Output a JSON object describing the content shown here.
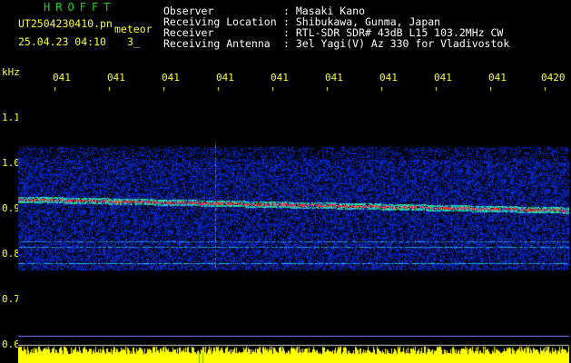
{
  "header": {
    "title": "HROFFT",
    "filename": "UT2504230410.pn",
    "filename_suffix": "meteor",
    "datetime": "25.04.23 04:10",
    "count": "3_",
    "observer_label": "Observer",
    "observer_value": ": Masaki Kano",
    "location_label": "Receiving Location",
    "location_value": ": Shibukawa, Gunma, Japan",
    "receiver_label": "Receiver",
    "receiver_value": ": RTL-SDR SDR# 43dB L15 103.2MHz CW",
    "antenna_label": "Receiving Antenna",
    "antenna_value": ": 3el Yagi(V) Az 330 for Vladivostok"
  },
  "axis": {
    "unit": "kHz",
    "y_ticks": [
      "1.1",
      "1.0",
      "0.9",
      "0.8",
      "0.7",
      "0.6"
    ],
    "x_ticks": [
      "041",
      "041",
      "041",
      "041",
      "041",
      "041",
      "041",
      "041",
      "041",
      "0420"
    ]
  },
  "colors": {
    "background": "#000000",
    "noise_band": "#1a2eb8",
    "signal_strong": "#ff2020",
    "signal_mid": "#20e0a0",
    "level_bar": "#ffff00",
    "axis_text": "#ffff33"
  }
}
